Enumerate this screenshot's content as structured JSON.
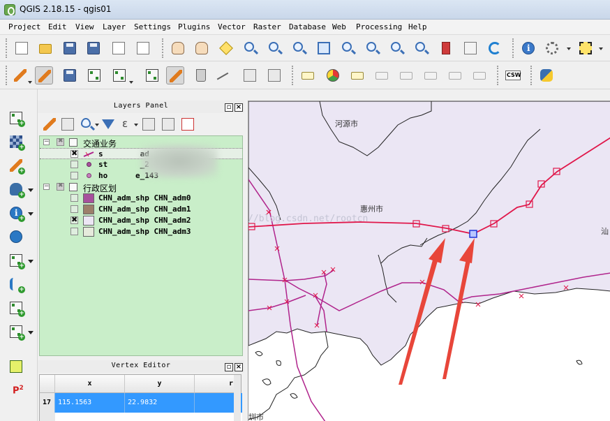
{
  "window": {
    "title": "QGIS 2.18.15 - qgis01"
  },
  "menu": [
    "Project",
    "Edit",
    "View",
    "Layer",
    "Settings",
    "Plugins",
    "Vector",
    "Raster",
    "Database",
    "Web",
    "Processing",
    "Help"
  ],
  "toolbar2": {
    "csw_label": "CSW"
  },
  "layers_panel": {
    "title": "Layers Panel",
    "groups": [
      {
        "name": "交通业务",
        "layers": [
          "s        ad",
          "st       _2",
          "ho      e_143"
        ]
      },
      {
        "name": "行政区划",
        "layers": [
          "CHN_adm_shp CHN_adm0",
          "CHN_adm_shp CHN_adm1",
          "CHN_adm_shp CHN_adm2",
          "CHN_adm_shp CHN_adm3"
        ]
      }
    ],
    "swatch_colors": [
      "#a7509c",
      "#9c7f6a",
      "#ece6f4",
      "#e6eadc"
    ]
  },
  "vertex_editor": {
    "title": "Vertex Editor",
    "columns": [
      "x",
      "y",
      "r"
    ],
    "rows": [
      {
        "num": "17",
        "x": "115.1563",
        "y": "22.9832"
      }
    ]
  },
  "map": {
    "labels": {
      "heyuan": "河源市",
      "huizhou": "惠州市",
      "shantou": "汕",
      "shenzhen": "圳市"
    },
    "watermark": "http://blog.csdn.net/rootcn",
    "colors": {
      "land": "#ebe6f4",
      "sea": "#ffffff",
      "route": "#e0174a",
      "route2": "#b0248c",
      "arrow": "#e8463a"
    }
  }
}
